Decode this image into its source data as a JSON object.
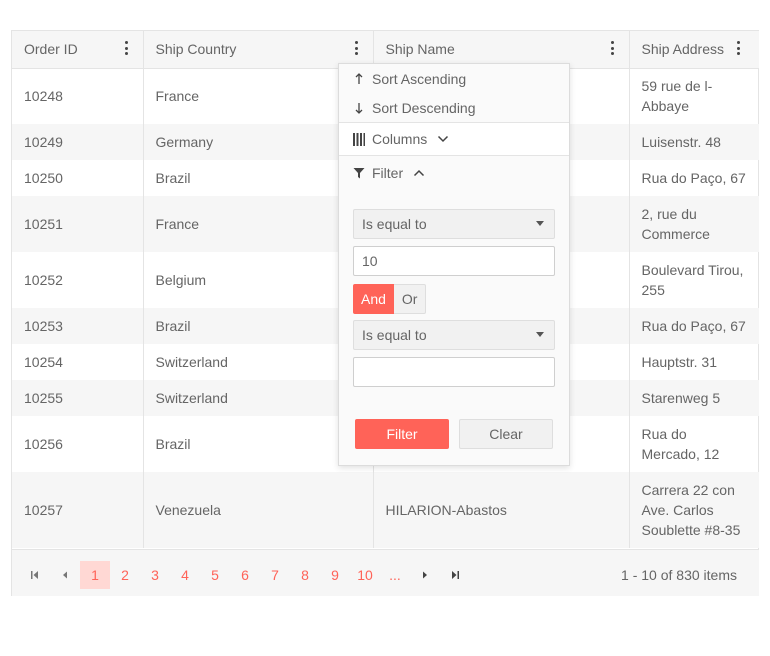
{
  "columns": [
    "Order ID",
    "Ship Country",
    "Ship Name",
    "Ship Address"
  ],
  "rows": [
    {
      "id": "10248",
      "country": "France",
      "name": "",
      "addr1": "59 rue de l-",
      "addr2": "Abbaye",
      "addr3": ""
    },
    {
      "id": "10249",
      "country": "Germany",
      "name": "",
      "addr1": "Luisenstr. 48",
      "addr2": "",
      "addr3": ""
    },
    {
      "id": "10250",
      "country": "Brazil",
      "name": "",
      "addr1": "Rua do Paço, 67",
      "addr2": "",
      "addr3": ""
    },
    {
      "id": "10251",
      "country": "France",
      "name": "",
      "addr1": "2, rue du",
      "addr2": "Commerce",
      "addr3": ""
    },
    {
      "id": "10252",
      "country": "Belgium",
      "name": "",
      "addr1": "Boulevard Tirou,",
      "addr2": "255",
      "addr3": ""
    },
    {
      "id": "10253",
      "country": "Brazil",
      "name": "",
      "addr1": "Rua do Paço, 67",
      "addr2": "",
      "addr3": ""
    },
    {
      "id": "10254",
      "country": "Switzerland",
      "name": "",
      "addr1": "Hauptstr. 31",
      "addr2": "",
      "addr3": ""
    },
    {
      "id": "10255",
      "country": "Switzerland",
      "name": "",
      "addr1": "Starenweg 5",
      "addr2": "",
      "addr3": ""
    },
    {
      "id": "10256",
      "country": "Brazil",
      "name": "",
      "addr1": "Rua do",
      "addr2": "Mercado, 12",
      "addr3": ""
    },
    {
      "id": "10257",
      "country": "Venezuela",
      "name": "HILARION-Abastos",
      "addr1": "Carrera 22 con",
      "addr2": "Ave. Carlos",
      "addr3": "Soublette #8-35"
    }
  ],
  "pager": {
    "pages": [
      "1",
      "2",
      "3",
      "4",
      "5",
      "6",
      "7",
      "8",
      "9",
      "10",
      "..."
    ],
    "current_page": "1",
    "info": "1 - 10 of 830 items"
  },
  "column_menu": {
    "sort_ascending": "Sort Ascending",
    "sort_descending": "Sort Descending",
    "columns": "Columns",
    "filter": "Filter",
    "operator1": "Is equal to",
    "value1": "10",
    "logic_and": "And",
    "logic_or": "Or",
    "operator2": "Is equal to",
    "value2": "",
    "filter_button": "Filter",
    "clear_button": "Clear"
  },
  "colors": {
    "accent": "#ff6358",
    "header_bg": "#f6f6f6",
    "border": "#e4e4e4",
    "text": "#656565"
  }
}
